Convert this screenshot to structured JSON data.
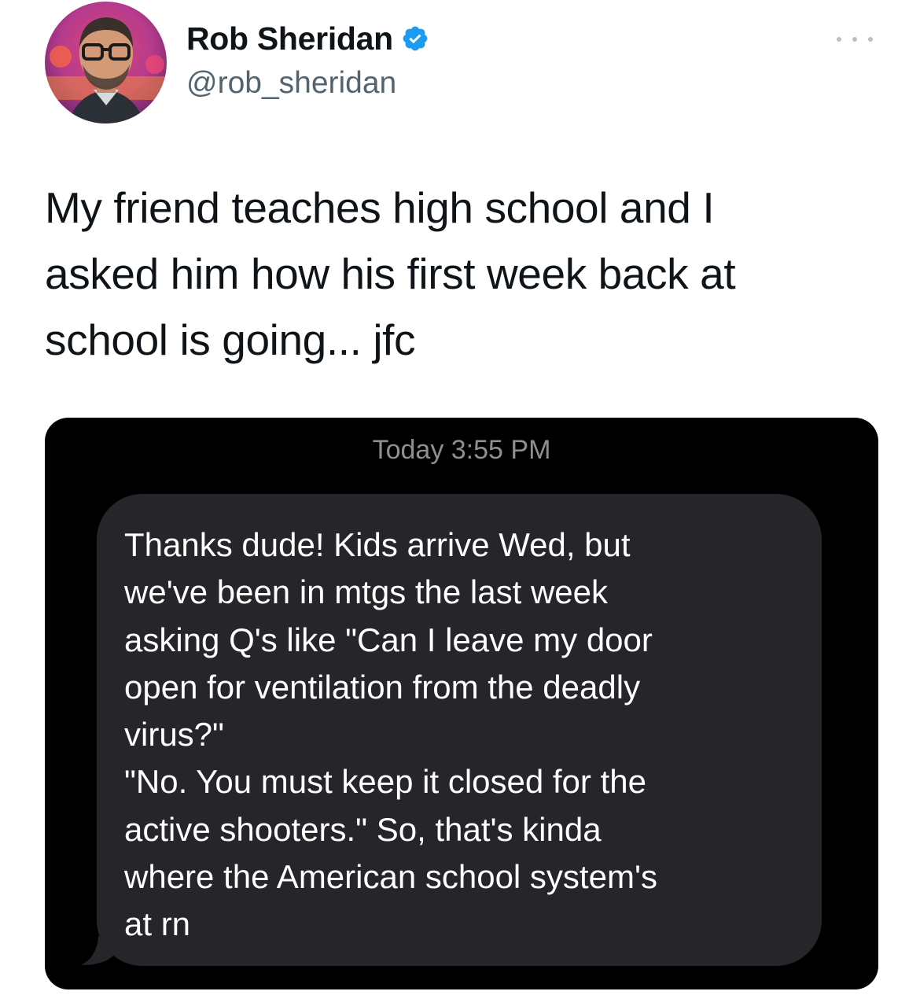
{
  "tweet": {
    "author": {
      "name": "Rob Sheridan",
      "handle": "@rob_sheridan",
      "verified": true,
      "avatar_icon": "avatar-photo",
      "verified_icon": "verified-badge-icon"
    },
    "more_icon": "more-options-icon",
    "text": "My friend teaches high school and I\nasked him how his first week back at\nschool is going... jfc"
  },
  "screenshot": {
    "timestamp": "Today 3:55 PM",
    "message": "Thanks dude! Kids arrive Wed, but\nwe've been in mtgs the last week\nasking Q's like \"Can I leave my door\nopen for ventilation from the deadly\nvirus?\"\n\"No. You must keep it closed for the\nactive shooters.\" So, that's kinda\nwhere the American school system's\nat rn"
  },
  "colors": {
    "verified_blue": "#1d9bf0",
    "handle_gray": "#536471",
    "bubble_gray": "#26252a",
    "media_background": "#000000"
  }
}
